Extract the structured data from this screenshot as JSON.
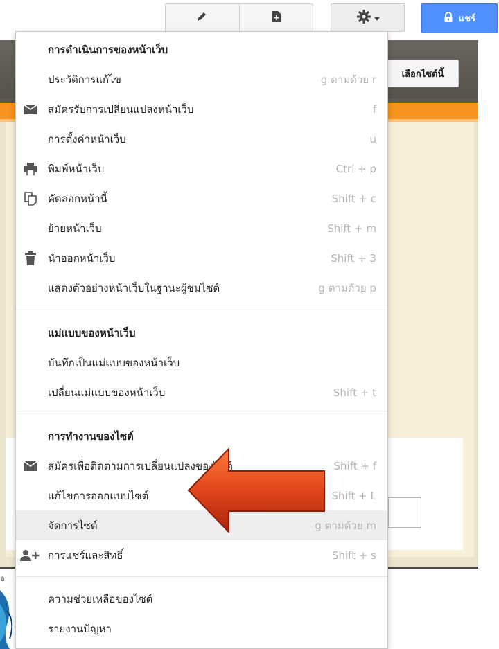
{
  "toolbar": {
    "edit_icon": "pencil-icon",
    "newpage_icon": "new-page-icon",
    "settings_icon": "gear-icon",
    "share_label": "แชร์",
    "share_icon": "lock-icon"
  },
  "background": {
    "choose_site_label": "เลือกไซต์นี้",
    "left_fragment": "อ"
  },
  "menu": {
    "section_page": "การดำเนินการของหน้าเว็บ",
    "page_items": [
      {
        "label": "ประวัติการแก้ไข",
        "shortcut": "g ตามด้วย r",
        "icon": ""
      },
      {
        "label": "สมัครรับการเปลี่ยนแปลงหน้าเว็บ",
        "shortcut": "f",
        "icon": "envelope-icon"
      },
      {
        "label": "การตั้งค่าหน้าเว็บ",
        "shortcut": "u",
        "icon": ""
      },
      {
        "label": "พิมพ์หน้าเว็บ",
        "shortcut": "Ctrl + p",
        "icon": "printer-icon"
      },
      {
        "label": "คัดลอกหน้านี้",
        "shortcut": "Shift + c",
        "icon": "copy-icon"
      },
      {
        "label": "ย้ายหน้าเว็บ",
        "shortcut": "Shift + m",
        "icon": ""
      },
      {
        "label": "นำออกหน้าเว็บ",
        "shortcut": "Shift + 3",
        "icon": "trash-icon"
      },
      {
        "label": "แสดงตัวอย่างหน้าเว็บในฐานะผู้ชมไซต์",
        "shortcut": "g ตามด้วย p",
        "icon": ""
      }
    ],
    "section_template": "แม่แบบของหน้าเว็บ",
    "template_items": [
      {
        "label": "บันทึกเป็นแม่แบบของหน้าเว็บ",
        "shortcut": ""
      },
      {
        "label": "เปลี่ยนแม่แบบของหน้าเว็บ",
        "shortcut": "Shift + t"
      }
    ],
    "section_site": "การทำงานของไซต์",
    "site_items": [
      {
        "label": "สมัครเพื่อติดตามการเปลี่ยนแปลงของไซต์",
        "shortcut": "Shift + f",
        "icon": "envelope-icon"
      },
      {
        "label": "แก้ไขการออกแบบไซต์",
        "shortcut": "Shift + L",
        "icon": ""
      },
      {
        "label": "จัดการไซต์",
        "shortcut": "g ตามด้วย m",
        "icon": ""
      },
      {
        "label": "การแชร์และสิทธิ์",
        "shortcut": "Shift + s",
        "icon": "add-person-icon"
      }
    ],
    "help_items": [
      {
        "label": "ความช่วยเหลือของไซต์"
      },
      {
        "label": "รายงานปัญหา"
      }
    ]
  },
  "colors": {
    "share_blue": "#4d90fe",
    "orange_bar": "#f7931e",
    "header_dark": "#5e5a54",
    "arrow_red": "#e0461c"
  }
}
